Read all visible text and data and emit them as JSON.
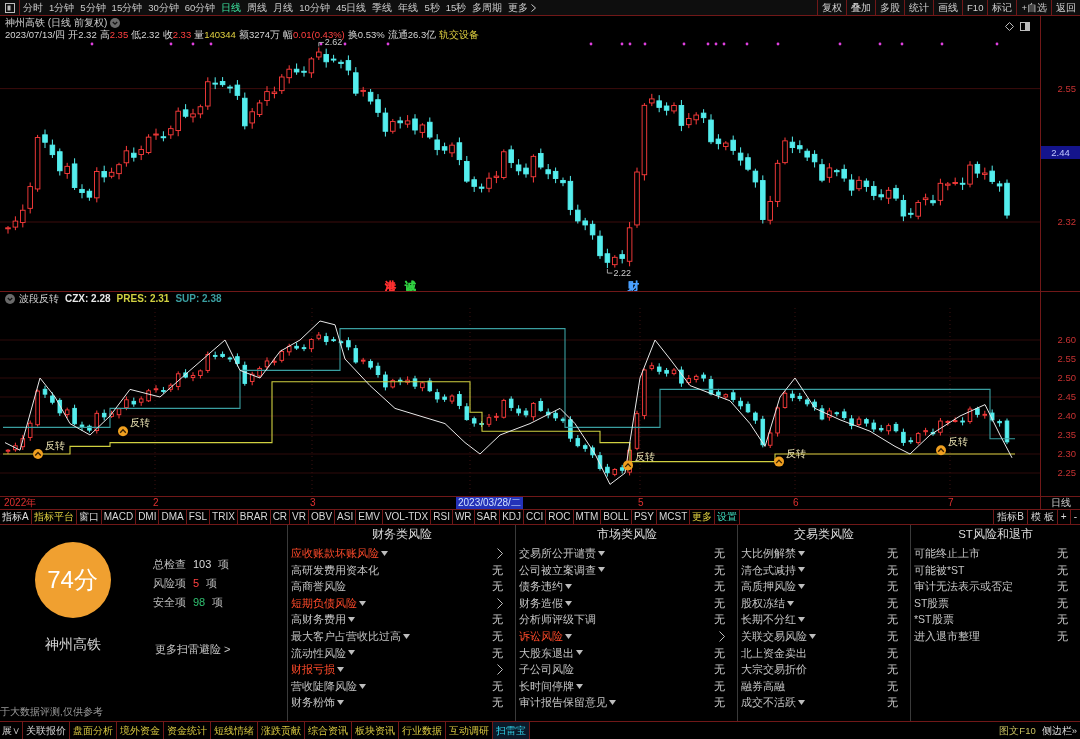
{
  "toolbar": {
    "periods": [
      {
        "label": "分时",
        "selected": false
      },
      {
        "label": "1分钟",
        "selected": false
      },
      {
        "label": "5分钟",
        "selected": false
      },
      {
        "label": "15分钟",
        "selected": false
      },
      {
        "label": "30分钟",
        "selected": false
      },
      {
        "label": "60分钟",
        "selected": false
      },
      {
        "label": "日线",
        "selected": true
      },
      {
        "label": "周线",
        "selected": false
      },
      {
        "label": "月线",
        "selected": false
      },
      {
        "label": "10分钟",
        "selected": false
      },
      {
        "label": "45日线",
        "selected": false
      },
      {
        "label": "季线",
        "selected": false
      },
      {
        "label": "年线",
        "selected": false
      },
      {
        "label": "5秒",
        "selected": false
      },
      {
        "label": "15秒",
        "selected": false
      },
      {
        "label": "多周期",
        "selected": false
      }
    ],
    "more": "更多",
    "buttons": [
      "复权",
      "叠加",
      "多股",
      "统计",
      "画线",
      "F10",
      "标记",
      "+自选",
      "返回"
    ]
  },
  "chart_header": {
    "title": "神州高铁 (日线 前复权)",
    "date": "2023/07/13/四",
    "fields": [
      {
        "label": "开",
        "value": "2.32",
        "kind": "flat"
      },
      {
        "label": "高",
        "value": "2.35",
        "kind": "up"
      },
      {
        "label": "低",
        "value": "2.32",
        "kind": "flat"
      },
      {
        "label": "收",
        "value": "2.33",
        "kind": "up"
      },
      {
        "label": "量",
        "value": "140344",
        "kind": "volume"
      },
      {
        "label": "额",
        "value": "3274万",
        "kind": "flat"
      },
      {
        "label": "幅",
        "value": "0.01(0.43%)",
        "kind": "up"
      },
      {
        "label": "换",
        "value": "0.53%",
        "kind": "flat"
      },
      {
        "label": "流通",
        "value": "26.3亿",
        "kind": "flat"
      }
    ],
    "sector": "轨交设备"
  },
  "main_chart": {
    "high_label": "2.62",
    "low_label": "2.22",
    "events": [
      {
        "label": "港",
        "color": "#ff3030"
      },
      {
        "label": "诚",
        "color": "#30d040"
      },
      {
        "label": "财",
        "color": "#4aa0ff"
      }
    ],
    "price_axis": [
      "2.55",
      "2.32"
    ],
    "current_price": "2.44"
  },
  "indicator": {
    "name": "波段反转",
    "series": [
      {
        "label": "CZX: 2.28",
        "color": "#e8e8e8"
      },
      {
        "label": "PRES: 2.31",
        "color": "#d0d040"
      },
      {
        "label": "SUP: 2.38",
        "color": "#3a9ea0"
      }
    ],
    "signals": [
      "反转",
      "反转",
      "反转",
      "反转",
      "反转"
    ],
    "price_axis": [
      "2.60",
      "2.55",
      "2.50",
      "2.45",
      "2.40",
      "2.35",
      "2.30",
      "2.25"
    ]
  },
  "date_axis": {
    "labels": [
      {
        "label": "2022年",
        "kind": "tick"
      },
      {
        "label": "2",
        "kind": "tick"
      },
      {
        "label": "3",
        "kind": "tick"
      },
      {
        "label": "2023/03/28/二",
        "kind": "cursor"
      },
      {
        "label": "5",
        "kind": "tick"
      },
      {
        "label": "6",
        "kind": "tick"
      },
      {
        "label": "7",
        "kind": "tick"
      }
    ],
    "period": "日线"
  },
  "indicator_tabs": {
    "first": "指标A",
    "platform": "指标平台",
    "items": [
      "窗口",
      "MACD",
      "DMI",
      "DMA",
      "FSL",
      "TRIX",
      "BRAR",
      "CR",
      "VR",
      "OBV",
      "ASI",
      "EMV",
      "VOL-TDX",
      "RSI",
      "WR",
      "SAR",
      "KDJ",
      "CCI",
      "ROC",
      "MTM",
      "BOLL",
      "PSY",
      "MCST"
    ],
    "more": "更多",
    "settings": "设置",
    "right": [
      "指标B",
      "模 板",
      "+",
      "-"
    ]
  },
  "risk_scan": {
    "score": "74分",
    "stock": "神州高铁",
    "stats": [
      {
        "label": "总检查",
        "value": "103",
        "unit": "项",
        "kind": "flat"
      },
      {
        "label": "风险项",
        "value": "5",
        "unit": "项",
        "kind": "risk"
      },
      {
        "label": "安全项",
        "value": "98",
        "unit": "项",
        "kind": "safe"
      }
    ],
    "more_link": "更多扫雷避险 >",
    "note": "于大数据评测,仅供参考",
    "columns": [
      {
        "title": "财务类风险",
        "rows": [
          {
            "name": "应收账款坏账风险",
            "caret": true,
            "risk": true
          },
          {
            "name": "高研发费用资本化",
            "caret": false,
            "risk": false,
            "value": "无"
          },
          {
            "name": "高商誉风险",
            "caret": false,
            "risk": false,
            "value": "无"
          },
          {
            "name": "短期负债风险",
            "caret": true,
            "risk": true
          },
          {
            "name": "高财务费用",
            "caret": true,
            "risk": false,
            "value": "无"
          },
          {
            "name": "最大客户占营收比过高",
            "caret": true,
            "risk": false,
            "value": "无"
          },
          {
            "name": "流动性风险",
            "caret": true,
            "risk": false,
            "value": "无"
          },
          {
            "name": "财报亏损",
            "caret": true,
            "risk": true
          },
          {
            "name": "营收陡降风险",
            "caret": true,
            "risk": false,
            "value": "无"
          },
          {
            "name": "财务粉饰",
            "caret": true,
            "risk": false,
            "value": "无"
          }
        ]
      },
      {
        "title": "市场类风险",
        "rows": [
          {
            "name": "交易所公开谴责",
            "caret": true,
            "risk": false,
            "value": "无"
          },
          {
            "name": "公司被立案调查",
            "caret": true,
            "risk": false,
            "value": "无"
          },
          {
            "name": "债务违约",
            "caret": true,
            "risk": false,
            "value": "无"
          },
          {
            "name": "财务造假",
            "caret": true,
            "risk": false,
            "value": "无"
          },
          {
            "name": "分析师评级下调",
            "caret": false,
            "risk": false,
            "value": "无"
          },
          {
            "name": "诉讼风险",
            "caret": true,
            "risk": true
          },
          {
            "name": "大股东退出",
            "caret": true,
            "risk": false,
            "value": "无"
          },
          {
            "name": "子公司风险",
            "caret": false,
            "risk": false,
            "value": "无"
          },
          {
            "name": "长时间停牌",
            "caret": true,
            "risk": false,
            "value": "无"
          },
          {
            "name": "审计报告保留意见",
            "caret": true,
            "risk": false,
            "value": "无"
          }
        ]
      },
      {
        "title": "交易类风险",
        "rows": [
          {
            "name": "大比例解禁",
            "caret": true,
            "risk": false,
            "value": "无"
          },
          {
            "name": "清仓式减持",
            "caret": true,
            "risk": false,
            "value": "无"
          },
          {
            "name": "高质押风险",
            "caret": true,
            "risk": false,
            "value": "无"
          },
          {
            "name": "股权冻结",
            "caret": true,
            "risk": false,
            "value": "无"
          },
          {
            "name": "长期不分红",
            "caret": true,
            "risk": false,
            "value": "无"
          },
          {
            "name": "关联交易风险",
            "caret": true,
            "risk": false,
            "value": "无"
          },
          {
            "name": "北上资金卖出",
            "caret": false,
            "risk": false,
            "value": "无"
          },
          {
            "name": "大宗交易折价",
            "caret": false,
            "risk": false,
            "value": "无"
          },
          {
            "name": "融券高融",
            "caret": false,
            "risk": false,
            "value": "无"
          },
          {
            "name": "成交不活跃",
            "caret": true,
            "risk": false,
            "value": "无"
          }
        ]
      },
      {
        "title": "ST风险和退市",
        "rows": [
          {
            "name": "可能终止上市",
            "caret": false,
            "risk": false,
            "value": "无"
          },
          {
            "name": "可能被*ST",
            "caret": false,
            "risk": false,
            "value": "无"
          },
          {
            "name": "审计无法表示或否定",
            "caret": false,
            "risk": false,
            "value": "无"
          },
          {
            "name": "ST股票",
            "caret": false,
            "risk": false,
            "value": "无"
          },
          {
            "name": "*ST股票",
            "caret": false,
            "risk": false,
            "value": "无"
          },
          {
            "name": "进入退市整理",
            "caret": false,
            "risk": false,
            "value": "无"
          }
        ]
      }
    ]
  },
  "bottom_bar": {
    "cut_tab": "展∨",
    "quote_tab": "关联报价",
    "tabs": [
      {
        "label": "盘面分析",
        "selected": false
      },
      {
        "label": "境外资金",
        "selected": false
      },
      {
        "label": "资金统计",
        "selected": false
      },
      {
        "label": "短线情绪",
        "selected": false
      },
      {
        "label": "涨跌贡献",
        "selected": false
      },
      {
        "label": "综合资讯",
        "selected": false
      },
      {
        "label": "板块资讯",
        "selected": false
      },
      {
        "label": "行业数据",
        "selected": false
      },
      {
        "label": "互动调研",
        "selected": false
      },
      {
        "label": "扫雷宝",
        "selected": true
      }
    ],
    "f10": "图文F10",
    "sidebar": "侧边栏»"
  }
}
